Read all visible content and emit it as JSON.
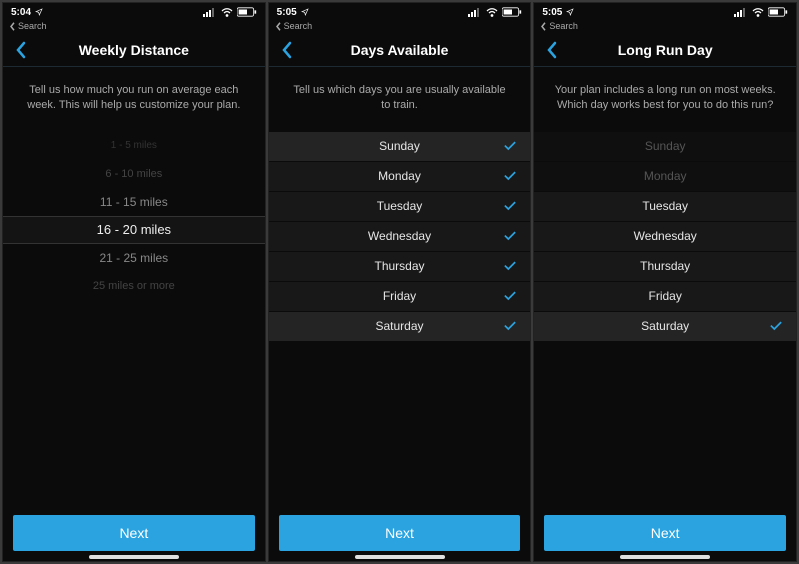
{
  "accent": "#2aa3e0",
  "screens": [
    {
      "status_time": "5:04",
      "breadcrumb_label": "Search",
      "title": "Weekly Distance",
      "prompt": "Tell us how much you run on average each week. This will help us customize your plan.",
      "picker": {
        "options": [
          {
            "label": "1 - 5 miles",
            "style": "vfar"
          },
          {
            "label": "6 - 10 miles",
            "style": "far"
          },
          {
            "label": "11 - 15 miles",
            "style": "near"
          },
          {
            "label": "16 - 20 miles",
            "style": "selected"
          },
          {
            "label": "21 - 25 miles",
            "style": "near"
          },
          {
            "label": "25 miles or more",
            "style": "far"
          }
        ]
      },
      "next_label": "Next"
    },
    {
      "status_time": "5:05",
      "breadcrumb_label": "Search",
      "title": "Days Available",
      "prompt": "Tell us which days you are usually available to train.",
      "days": [
        {
          "label": "Sunday",
          "checked": true,
          "highlight": true
        },
        {
          "label": "Monday",
          "checked": true
        },
        {
          "label": "Tuesday",
          "checked": true
        },
        {
          "label": "Wednesday",
          "checked": true
        },
        {
          "label": "Thursday",
          "checked": true
        },
        {
          "label": "Friday",
          "checked": true
        },
        {
          "label": "Saturday",
          "checked": true,
          "highlight": true
        }
      ],
      "next_label": "Next"
    },
    {
      "status_time": "5:05",
      "breadcrumb_label": "Search",
      "title": "Long Run Day",
      "prompt": "Your plan includes a long run on most weeks. Which day works best for you to do this run?",
      "days": [
        {
          "label": "Sunday",
          "dim": true
        },
        {
          "label": "Monday",
          "dim": true
        },
        {
          "label": "Tuesday"
        },
        {
          "label": "Wednesday"
        },
        {
          "label": "Thursday"
        },
        {
          "label": "Friday"
        },
        {
          "label": "Saturday",
          "checked": true,
          "highlight": true
        }
      ],
      "next_label": "Next"
    }
  ]
}
